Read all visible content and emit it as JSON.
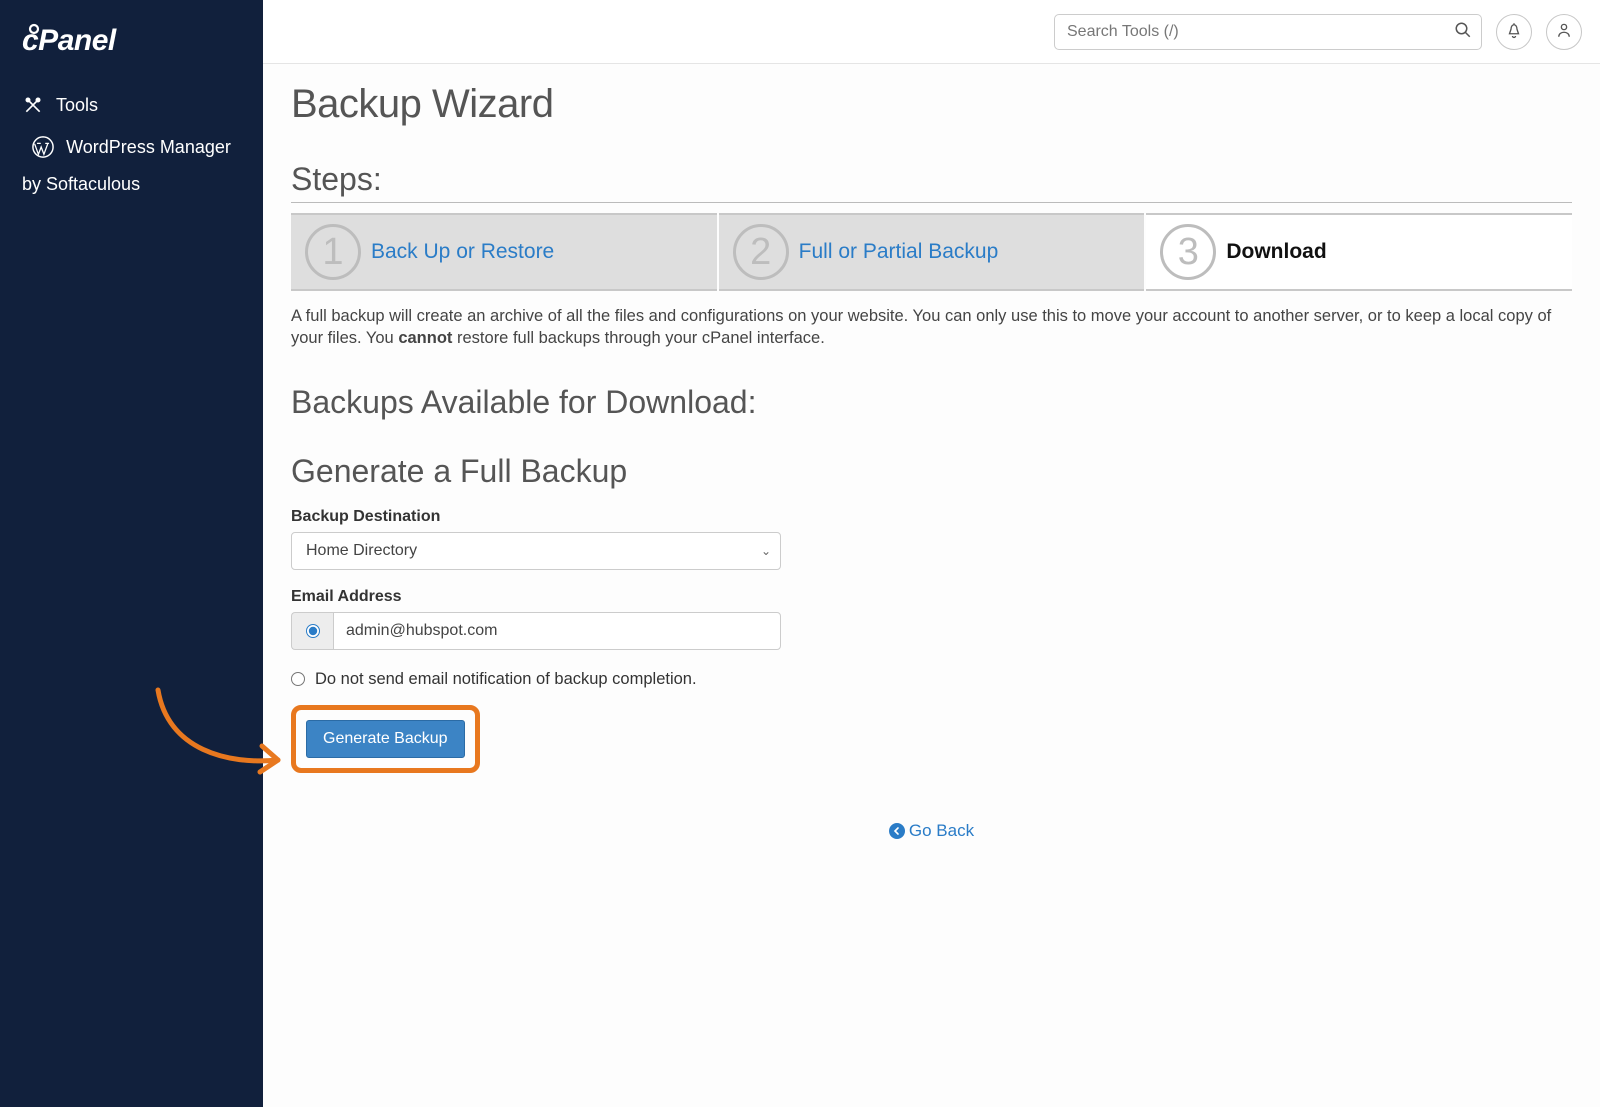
{
  "brand": "cPanel",
  "sidebar": {
    "items": [
      {
        "label": "Tools",
        "icon": "tools-icon"
      },
      {
        "label_line1": "WordPress Manager",
        "label_line2": "by Softaculous",
        "icon": "wordpress-icon"
      }
    ]
  },
  "header": {
    "search_placeholder": "Search Tools (/)"
  },
  "page": {
    "title": "Backup Wizard",
    "steps_heading": "Steps:",
    "steps": [
      {
        "num": "1",
        "label": "Back Up or Restore",
        "active": false
      },
      {
        "num": "2",
        "label": "Full or Partial Backup",
        "active": false
      },
      {
        "num": "3",
        "label": "Download",
        "active": true
      }
    ],
    "description_pre": "A full backup will create an archive of all the files and configurations on your website. You can only use this to move your account to another server, or to keep a local copy of your files. You ",
    "description_bold": "cannot",
    "description_post": " restore full backups through your cPanel interface.",
    "available_heading": "Backups Available for Download:",
    "generate_heading": "Generate a Full Backup",
    "form": {
      "destination_label": "Backup Destination",
      "destination_value": "Home Directory",
      "email_label": "Email Address",
      "email_value": "admin@hubspot.com",
      "no_email_label": "Do not send email notification of backup completion.",
      "submit_label": "Generate Backup"
    },
    "go_back": "Go Back"
  }
}
